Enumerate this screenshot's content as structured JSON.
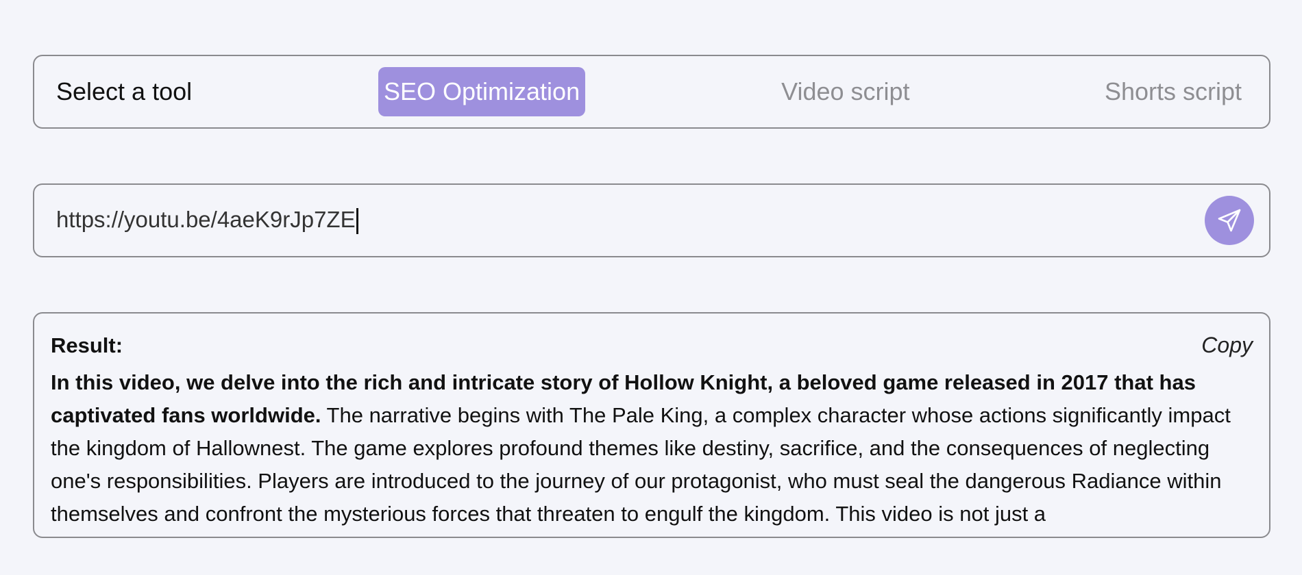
{
  "toolbar": {
    "label": "Select a tool",
    "tabs": [
      {
        "label": "SEO Optimization",
        "active": true
      },
      {
        "label": "Video script",
        "active": false
      },
      {
        "label": "Shorts script",
        "active": false
      }
    ]
  },
  "url_input": {
    "value": "https://youtu.be/4aeK9rJp7ZE",
    "send_icon": "paper-plane-icon"
  },
  "result": {
    "label": "Result:",
    "copy_label": "Copy",
    "lead": "In this video, we delve into the rich and intricate story of Hollow Knight, a beloved game released in 2017 that has captivated fans worldwide.",
    "body": " The narrative begins with The Pale King, a complex character whose actions significantly impact the kingdom of Hallownest. The game explores profound themes like destiny, sacrifice, and the consequences of neglecting one's responsibilities. Players are introduced to the journey of our protagonist, who must seal the dangerous Radiance within themselves and confront the mysterious forces that threaten to engulf the kingdom. This video is not just a"
  },
  "colors": {
    "accent": "#9e90de",
    "background": "#f4f5fa",
    "border": "#8a8a8e",
    "inactive_text": "#8e8e92"
  }
}
